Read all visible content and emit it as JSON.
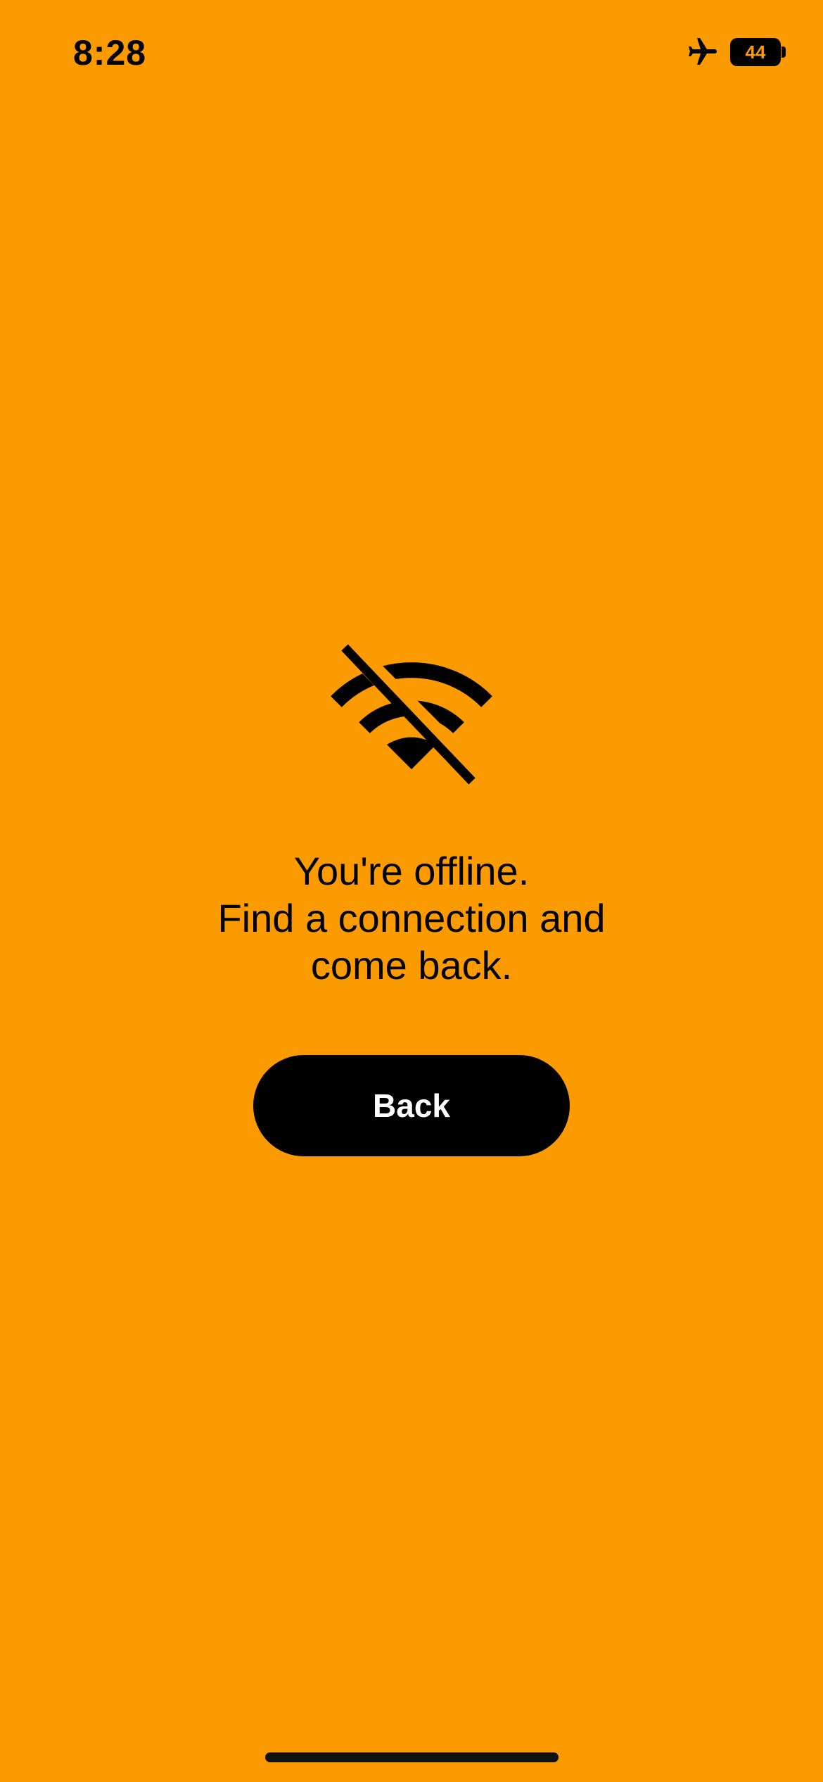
{
  "status_bar": {
    "time": "8:28",
    "airplane_mode_icon": "airplane-icon",
    "battery_level": "44"
  },
  "offline_screen": {
    "icon": "wifi-off-icon",
    "message_lines": [
      "You're offline.",
      "Find a connection and",
      "come back."
    ],
    "back_button_label": "Back"
  },
  "colors": {
    "background": "#FB9B00",
    "foreground": "#000000",
    "button_text": "#FFFFFF"
  }
}
